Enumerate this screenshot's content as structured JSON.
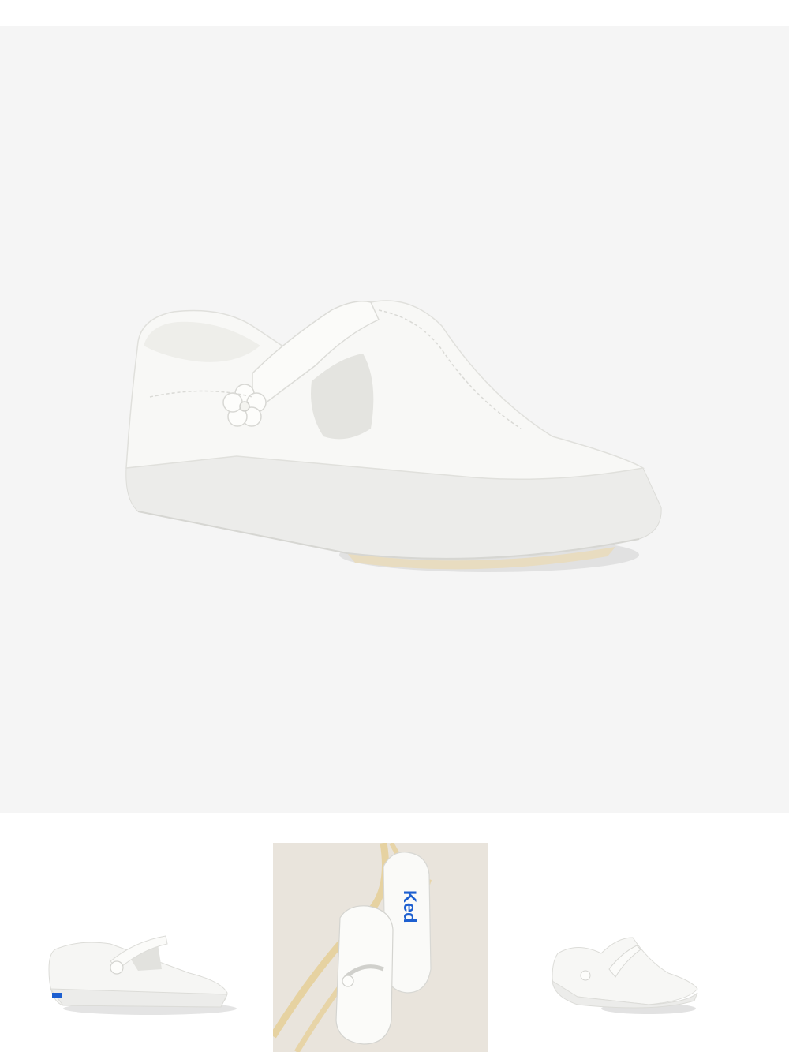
{
  "gallery": {
    "main_image": {
      "subject": "shoe-white-tstrap",
      "background_color": "#f5f5f5"
    },
    "thumbnails": [
      {
        "subject": "shoe-side-view",
        "background_color": "#ffffff"
      },
      {
        "subject": "shoe-pair-gift",
        "background_color": "#e9e4dc",
        "brand_text": "Ked"
      },
      {
        "subject": "shoe-angle-view",
        "background_color": "#ffffff"
      }
    ]
  },
  "colors": {
    "shoe_white": "#f7f6f3",
    "shadow": "#d9d9d9",
    "brand_blue": "#1d5fd0",
    "ribbon": "#e6cf9a"
  }
}
